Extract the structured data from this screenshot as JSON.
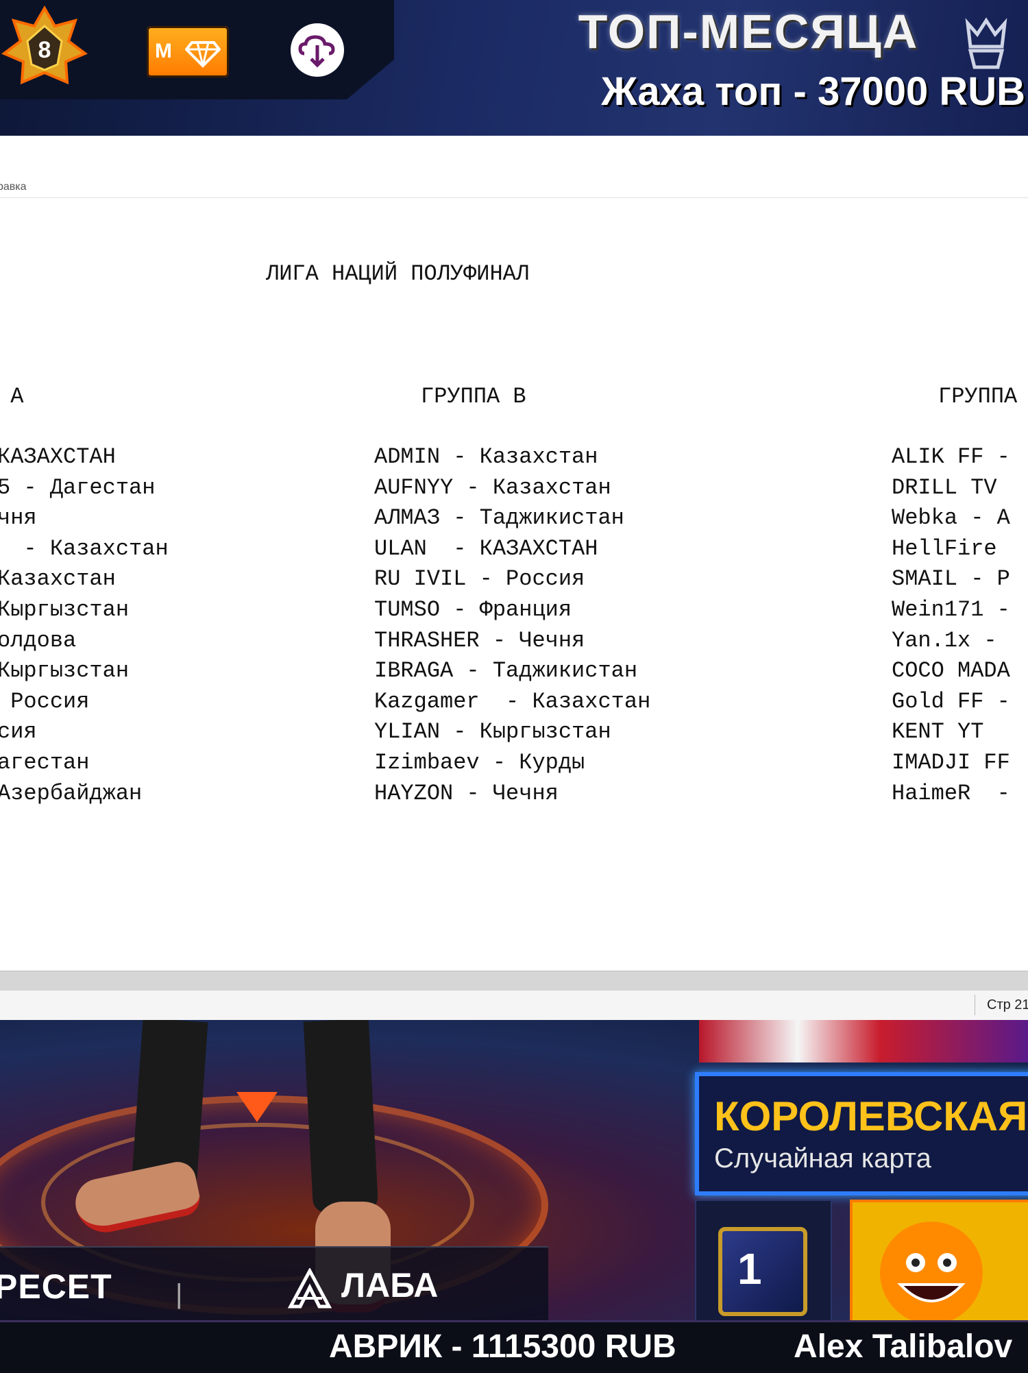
{
  "top_banner": {
    "rank_number": "8",
    "diamond_label": "M",
    "title": "ТОП-МЕСЯЦА",
    "subtitle": "Жаха топ - 37000 RUB",
    "icons": [
      "rank-badge-icon",
      "diamond-icon",
      "cloud-download-icon",
      "crown-icon"
    ],
    "colors": {
      "accent_gold": "#ff9a00",
      "banner_bg": "#1b2a63"
    }
  },
  "document": {
    "menu_fragment": "равка",
    "title": "ЛИГА НАЦИЙ ПОЛУФИНАЛ",
    "groups": [
      {
        "header": " А",
        "items": [
          "КАЗАХСТАН",
          "5 - Дагестан",
          "чня",
          "  - Казахстан",
          "Казахстан",
          "Кыргызстан",
          "олдова",
          "Кыргызстан",
          " Россия",
          "сия",
          "агестан",
          "Азербайджан"
        ]
      },
      {
        "header": "ГРУППА В",
        "items": [
          "ADMIN - Казахстан",
          "AUFNYY - Казахстан",
          "АЛМАЗ - Таджикистан",
          "ULAN  - КАЗАХСТАН",
          "RU IVIL - Россия",
          "TUMSO - Франция",
          "THRASHER - Чечня",
          "IBRAGA - Таджикистан",
          "Kazgamer  - Казахстан",
          "YLIAN - Кыргызстан",
          "Izimbaev - Курды",
          "HAYZON - Чечня"
        ]
      },
      {
        "header": "ГРУППА",
        "items": [
          "ALIK FF -",
          "DRILL TV",
          "Webka - А",
          "HellFire",
          "SMAIL - Р",
          "Wein171 -",
          "Yan.1x -",
          "COCO MADA",
          "Gold FF -",
          "KENT YT",
          "IMADJI FF",
          "HaimeR  -"
        ]
      }
    ],
    "status_page": "Стр 21"
  },
  "game_scene": {
    "preset_button": "РЕСЕТ",
    "divider": "|",
    "lab_button": "ЛАБА",
    "mode_title": "КОРОЛЕВСКАЯ БИ",
    "mode_subtitle": "Случайная карта",
    "dice_number": "1",
    "icons": [
      "lab-logo-icon",
      "dice-icon",
      "smile-face-icon",
      "arrow-marker-icon"
    ]
  },
  "ticker": {
    "item_a": "АВРИК - 1115300 RUB",
    "item_b": "Alex Talibalov"
  }
}
